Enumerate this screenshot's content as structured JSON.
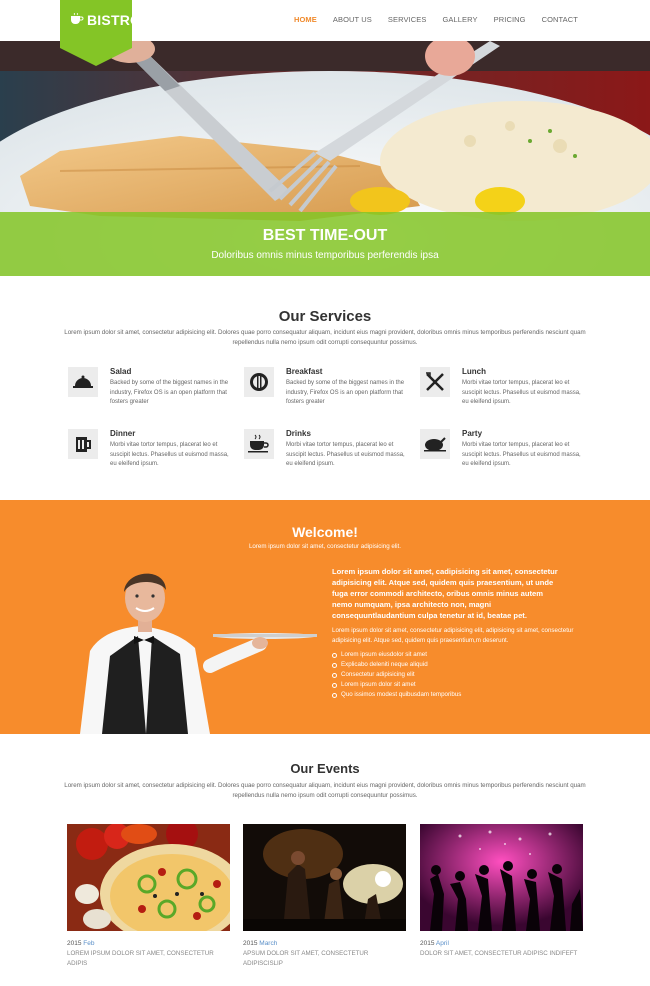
{
  "brand": {
    "name": "BISTRO"
  },
  "nav": {
    "items": [
      {
        "label": "HOME",
        "active": true
      },
      {
        "label": "ABOUT US",
        "active": false
      },
      {
        "label": "SERVICES",
        "active": false
      },
      {
        "label": "GALLERY",
        "active": false
      },
      {
        "label": "PRICING",
        "active": false
      },
      {
        "label": "CONTACT",
        "active": false
      }
    ]
  },
  "hero": {
    "title": "BEST TIME-OUT",
    "subtitle": "Doloribus omnis minus temporibus perferendis ipsa"
  },
  "services": {
    "title": "Our Services",
    "description": "Lorem ipsum dolor sit amet, consectetur adipisicing elit. Dolores quae porro consequatur aliquam, incidunt eius magni provident, doloribus omnis minus temporibus perferendis nesciunt quam repellendus nulla nemo ipsum odit corrupti consequuntur possimus.",
    "items": [
      {
        "title": "Salad",
        "icon": "cloche-icon",
        "text": "Backed by some of the biggest names in the industry, Firefox OS is an open platform that fosters greater"
      },
      {
        "title": "Breakfast",
        "icon": "plate-cutlery-icon",
        "text": "Backed by some of the biggest names in the industry, Firefox OS is an open platform that fosters greater"
      },
      {
        "title": "Lunch",
        "icon": "fork-knife-icon",
        "text": "Morbi vitae tortor tempus, placerat leo et suscipit lectus. Phasellus ut euismod massa, eu eleifend ipsum."
      },
      {
        "title": "Dinner",
        "icon": "beer-mug-icon",
        "text": "Morbi vitae tortor tempus, placerat leo et suscipit lectus. Phasellus ut euismod massa, eu eleifend ipsum."
      },
      {
        "title": "Drinks",
        "icon": "coffee-cup-icon",
        "text": "Morbi vitae tortor tempus, placerat leo et suscipit lectus. Phasellus ut euismod massa, eu eleifend ipsum."
      },
      {
        "title": "Party",
        "icon": "roast-chicken-icon",
        "text": "Morbi vitae tortor tempus, placerat leo et suscipit lectus. Phasellus ut euismod massa, eu eleifend ipsum."
      }
    ]
  },
  "welcome": {
    "title": "Welcome!",
    "subtitle": "Lorem ipsum dolor sit amet, consectetur adipisicing elit.",
    "lead": "Lorem ipsum dolor sit amet, cadipisicing sit amet, consectetur adipisicing elit. Atque sed, quidem quis praesentium, ut unde fuga error commodi architecto, laudantium culpa tenetur at id, beatae pet.",
    "lead_lines": [
      "Lorem ipsum dolor sit amet, cadipisicing sit amet, consectetur",
      "adipisicing elit. Atque sed, quidem quis praesentium, ut unde",
      "fuga error commodi architecto, oribus omnis minus autem",
      "nemo numquam, ipsa architecto non, magni",
      "consequuntlaudantium culpa tenetur at id, beatae pet."
    ],
    "text": "Lorem ipsum dolor sit amet, consectetur adipisicing elit, adipisicing sit amet, consectetur adipisicing elit. Atque sed, quidem quis praesentium,m deserunt.",
    "list": [
      "Lorem ipsum eiusdolor sit amet",
      "Explicabo deleniti neque aliquid",
      "Consectetur adipisicing elit",
      "Lorem ipsum dolor sit amet",
      "Quo issimos modest quibusdam temporibus"
    ]
  },
  "events": {
    "title": "Our Events",
    "description": "Lorem ipsum dolor sit amet, consectetur adipisicing elit. Dolores quae porro consequatur aliquam, incidunt eius magni provident, doloribus omnis minus temporibus perferendis nesciunt quam repellendus nulla nemo ipsum odit corrupti consequuntur possimus.",
    "items": [
      {
        "year": "2015",
        "month": "Feb",
        "text": "LOREM IPSUM DOLOR SIT AMET, CONSECTETUR ADIPIS"
      },
      {
        "year": "2015",
        "month": "March",
        "text": "APSUM DOLOR SIT AMET, CONSECTETUR ADIPISCISLIP"
      },
      {
        "year": "2015",
        "month": "April",
        "text": "DOLOR SIT AMET, CONSECTETUR ADIPISC INDIFEFT"
      }
    ]
  },
  "colors": {
    "green": "#84c526",
    "orange": "#f78c2c",
    "nav_active": "#f08a2c"
  }
}
